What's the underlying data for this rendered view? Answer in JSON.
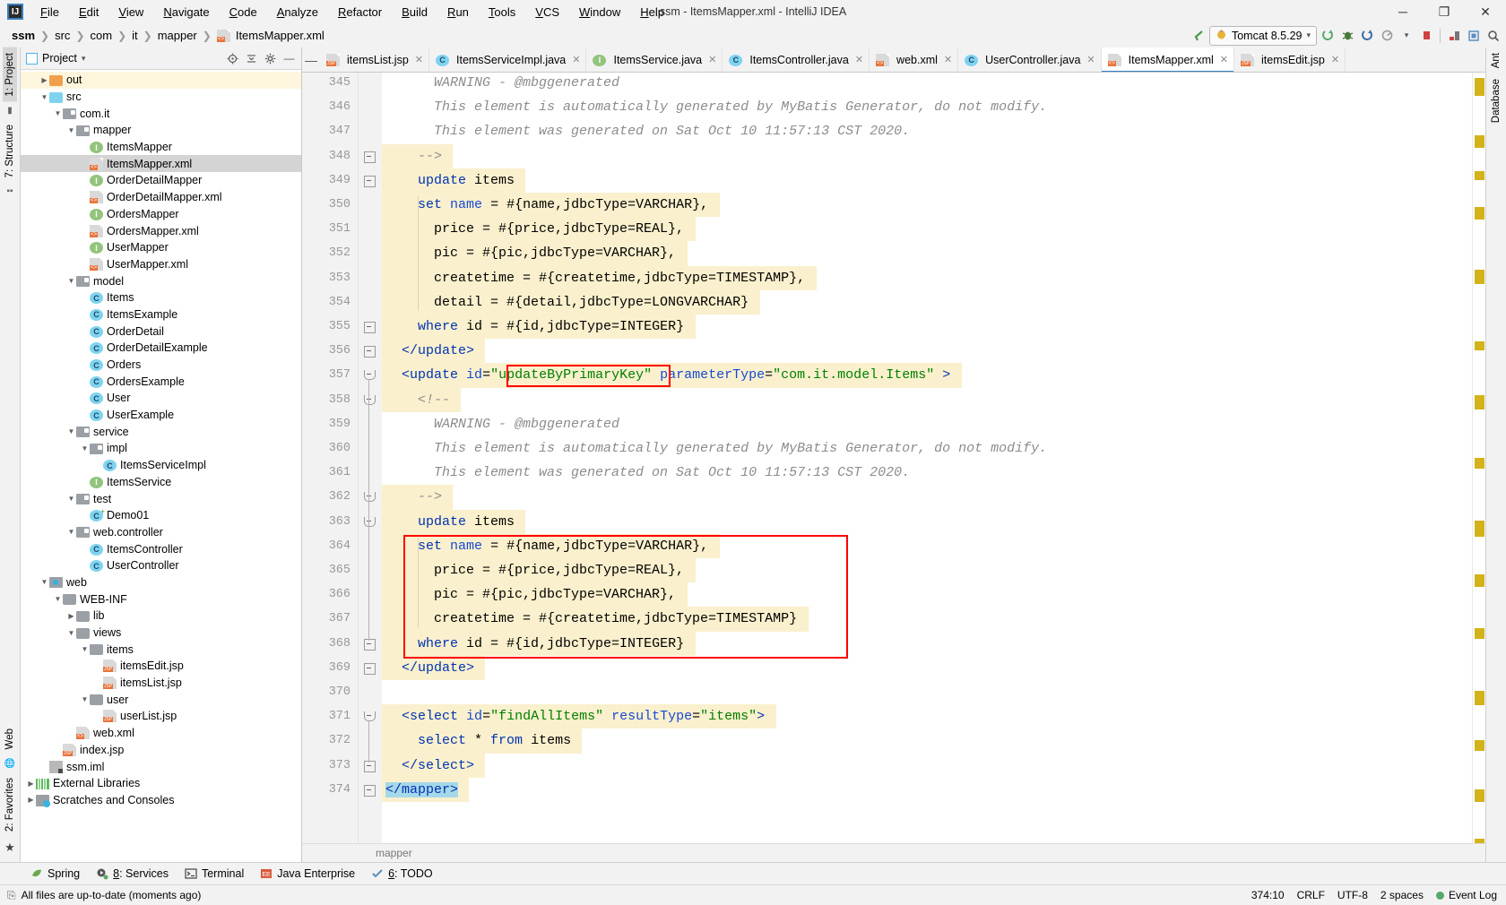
{
  "window": {
    "title": "ssm - ItemsMapper.xml - IntelliJ IDEA",
    "logo": "IJ",
    "minimize": "─",
    "maximize": "❐",
    "close": "✕"
  },
  "menu": [
    "File",
    "Edit",
    "View",
    "Navigate",
    "Code",
    "Analyze",
    "Refactor",
    "Build",
    "Run",
    "Tools",
    "VCS",
    "Window",
    "Help"
  ],
  "breadcrumbs": [
    {
      "label": "ssm",
      "bold": true,
      "icon": ""
    },
    {
      "label": "src",
      "bold": false,
      "icon": ""
    },
    {
      "label": "com",
      "bold": false,
      "icon": ""
    },
    {
      "label": "it",
      "bold": false,
      "icon": ""
    },
    {
      "label": "mapper",
      "bold": false,
      "icon": ""
    },
    {
      "label": "ItemsMapper.xml",
      "bold": false,
      "icon": "xml-file-icon"
    }
  ],
  "toolbar": {
    "back_arrow": "↖",
    "run_config": "Tomcat 8.5.29",
    "run_config_caret": "▾",
    "icons": [
      "run-icon",
      "debug-icon",
      "run-with-coverage-icon",
      "profile-icon",
      "profile-caret",
      "stop-icon",
      "build-icon",
      "app-icon",
      "search-everywhere-icon"
    ]
  },
  "left_strip": {
    "tabs": [
      {
        "label": "1: Project",
        "selected": true
      },
      {
        "label": "7: Structure",
        "selected": false
      }
    ],
    "bottom_tabs": [
      {
        "label": "Web"
      },
      {
        "label": "2: Favorites"
      }
    ]
  },
  "right_strip": {
    "tabs": [
      "Ant",
      "Database"
    ]
  },
  "project_panel": {
    "title": "Project",
    "title_caret": "▾",
    "header_icons": [
      "locate-icon",
      "collapse-all-icon",
      "settings-icon",
      "hide-icon"
    ],
    "tree": [
      {
        "label": "out",
        "depth": 1,
        "arrow": "▶",
        "icon": "folder-orange",
        "state": "highlight"
      },
      {
        "label": "src",
        "depth": 1,
        "arrow": "▼",
        "icon": "folder-blue",
        "state": ""
      },
      {
        "label": "com.it",
        "depth": 2,
        "arrow": "▼",
        "icon": "package",
        "state": ""
      },
      {
        "label": "mapper",
        "depth": 3,
        "arrow": "▼",
        "icon": "package",
        "state": ""
      },
      {
        "label": "ItemsMapper",
        "depth": 4,
        "arrow": "",
        "icon": "interface",
        "state": ""
      },
      {
        "label": "ItemsMapper.xml",
        "depth": 4,
        "arrow": "",
        "icon": "xml",
        "state": "selected"
      },
      {
        "label": "OrderDetailMapper",
        "depth": 4,
        "arrow": "",
        "icon": "interface",
        "state": ""
      },
      {
        "label": "OrderDetailMapper.xml",
        "depth": 4,
        "arrow": "",
        "icon": "xml",
        "state": ""
      },
      {
        "label": "OrdersMapper",
        "depth": 4,
        "arrow": "",
        "icon": "interface",
        "state": ""
      },
      {
        "label": "OrdersMapper.xml",
        "depth": 4,
        "arrow": "",
        "icon": "xml",
        "state": ""
      },
      {
        "label": "UserMapper",
        "depth": 4,
        "arrow": "",
        "icon": "interface",
        "state": ""
      },
      {
        "label": "UserMapper.xml",
        "depth": 4,
        "arrow": "",
        "icon": "xml",
        "state": ""
      },
      {
        "label": "model",
        "depth": 3,
        "arrow": "▼",
        "icon": "package",
        "state": ""
      },
      {
        "label": "Items",
        "depth": 4,
        "arrow": "",
        "icon": "class",
        "state": ""
      },
      {
        "label": "ItemsExample",
        "depth": 4,
        "arrow": "",
        "icon": "class",
        "state": ""
      },
      {
        "label": "OrderDetail",
        "depth": 4,
        "arrow": "",
        "icon": "class",
        "state": ""
      },
      {
        "label": "OrderDetailExample",
        "depth": 4,
        "arrow": "",
        "icon": "class",
        "state": ""
      },
      {
        "label": "Orders",
        "depth": 4,
        "arrow": "",
        "icon": "class",
        "state": ""
      },
      {
        "label": "OrdersExample",
        "depth": 4,
        "arrow": "",
        "icon": "class",
        "state": ""
      },
      {
        "label": "User",
        "depth": 4,
        "arrow": "",
        "icon": "class",
        "state": ""
      },
      {
        "label": "UserExample",
        "depth": 4,
        "arrow": "",
        "icon": "class",
        "state": ""
      },
      {
        "label": "service",
        "depth": 3,
        "arrow": "▼",
        "icon": "package",
        "state": ""
      },
      {
        "label": "impl",
        "depth": 4,
        "arrow": "▼",
        "icon": "package",
        "state": ""
      },
      {
        "label": "ItemsServiceImpl",
        "depth": 5,
        "arrow": "",
        "icon": "class",
        "state": ""
      },
      {
        "label": "ItemsService",
        "depth": 4,
        "arrow": "",
        "icon": "interface",
        "state": ""
      },
      {
        "label": "test",
        "depth": 3,
        "arrow": "▼",
        "icon": "package",
        "state": ""
      },
      {
        "label": "Demo01",
        "depth": 4,
        "arrow": "",
        "icon": "class-test",
        "state": ""
      },
      {
        "label": "web.controller",
        "depth": 3,
        "arrow": "▼",
        "icon": "package",
        "state": ""
      },
      {
        "label": "ItemsController",
        "depth": 4,
        "arrow": "",
        "icon": "class",
        "state": ""
      },
      {
        "label": "UserController",
        "depth": 4,
        "arrow": "",
        "icon": "class",
        "state": ""
      },
      {
        "label": "web",
        "depth": 1,
        "arrow": "▼",
        "icon": "webfolder",
        "state": ""
      },
      {
        "label": "WEB-INF",
        "depth": 2,
        "arrow": "▼",
        "icon": "folder",
        "state": ""
      },
      {
        "label": "lib",
        "depth": 3,
        "arrow": "▶",
        "icon": "folder",
        "state": ""
      },
      {
        "label": "views",
        "depth": 3,
        "arrow": "▼",
        "icon": "folder",
        "state": ""
      },
      {
        "label": "items",
        "depth": 4,
        "arrow": "▼",
        "icon": "folder",
        "state": ""
      },
      {
        "label": "itemsEdit.jsp",
        "depth": 5,
        "arrow": "",
        "icon": "jsp",
        "state": ""
      },
      {
        "label": "itemsList.jsp",
        "depth": 5,
        "arrow": "",
        "icon": "jsp",
        "state": ""
      },
      {
        "label": "user",
        "depth": 4,
        "arrow": "▼",
        "icon": "folder",
        "state": ""
      },
      {
        "label": "userList.jsp",
        "depth": 5,
        "arrow": "",
        "icon": "jsp",
        "state": ""
      },
      {
        "label": "web.xml",
        "depth": 3,
        "arrow": "",
        "icon": "xmlweb",
        "state": ""
      },
      {
        "label": "index.jsp",
        "depth": 2,
        "arrow": "",
        "icon": "jsp",
        "state": ""
      },
      {
        "label": "ssm.iml",
        "depth": 1,
        "arrow": "",
        "icon": "iml",
        "state": ""
      },
      {
        "label": "External Libraries",
        "depth": 0,
        "arrow": "▶",
        "icon": "library",
        "state": ""
      },
      {
        "label": "Scratches and Consoles",
        "depth": 0,
        "arrow": "▶",
        "icon": "scratch",
        "state": ""
      }
    ]
  },
  "editor_tabs": [
    {
      "label": "itemsList.jsp",
      "icon": "jsp",
      "active": false
    },
    {
      "label": "ItemsServiceImpl.java",
      "icon": "class",
      "active": false
    },
    {
      "label": "ItemsService.java",
      "icon": "interface",
      "active": false
    },
    {
      "label": "ItemsController.java",
      "icon": "class",
      "active": false
    },
    {
      "label": "web.xml",
      "icon": "xmlweb",
      "active": false
    },
    {
      "label": "UserController.java",
      "icon": "class",
      "active": false
    },
    {
      "label": "ItemsMapper.xml",
      "icon": "xml",
      "active": true
    },
    {
      "label": "itemsEdit.jsp",
      "icon": "jsp",
      "active": false
    }
  ],
  "editor": {
    "first_line_number": 345,
    "breadcrumb": "mapper",
    "lines": [
      {
        "n": 345,
        "tokens": [
          {
            "t": "      WARNING - @mbggenerated",
            "c": "cmt"
          }
        ],
        "hl": false
      },
      {
        "n": 346,
        "tokens": [
          {
            "t": "      This element is automatically generated by MyBatis Generator, do not modify.",
            "c": "cmt"
          }
        ],
        "hl": false
      },
      {
        "n": 347,
        "tokens": [
          {
            "t": "      This element was generated on Sat Oct 10 11:57:13 CST 2020.",
            "c": "cmt"
          }
        ],
        "hl": false
      },
      {
        "n": 348,
        "tokens": [
          {
            "t": "    -->",
            "c": "cmt"
          }
        ],
        "hl": true
      },
      {
        "n": 349,
        "tokens": [
          {
            "t": "    ",
            "c": "txt"
          },
          {
            "t": "update",
            "c": "kw"
          },
          {
            "t": " items",
            "c": "txt"
          }
        ],
        "hl": true
      },
      {
        "n": 350,
        "tokens": [
          {
            "t": "    ",
            "c": "txt"
          },
          {
            "t": "set",
            "c": "kw"
          },
          {
            "t": " ",
            "c": "txt"
          },
          {
            "t": "name",
            "c": "attr"
          },
          {
            "t": " = #{name,jdbcType=VARCHAR},",
            "c": "txt"
          }
        ],
        "hl": true
      },
      {
        "n": 351,
        "tokens": [
          {
            "t": "      price = #{price,jdbcType=REAL},",
            "c": "txt"
          }
        ],
        "hl": true
      },
      {
        "n": 352,
        "tokens": [
          {
            "t": "      pic = #{pic,jdbcType=VARCHAR},",
            "c": "txt"
          }
        ],
        "hl": true
      },
      {
        "n": 353,
        "tokens": [
          {
            "t": "      createtime = #{createtime,jdbcType=TIMESTAMP},",
            "c": "txt"
          }
        ],
        "hl": true
      },
      {
        "n": 354,
        "tokens": [
          {
            "t": "      detail = #{detail,jdbcType=LONGVARCHAR}",
            "c": "txt"
          }
        ],
        "hl": true
      },
      {
        "n": 355,
        "tokens": [
          {
            "t": "    ",
            "c": "txt"
          },
          {
            "t": "where",
            "c": "kw"
          },
          {
            "t": " id = #{id,jdbcType=INTEGER}",
            "c": "txt"
          }
        ],
        "hl": true
      },
      {
        "n": 356,
        "tokens": [
          {
            "t": "  ",
            "c": "txt"
          },
          {
            "t": "</update>",
            "c": "tag"
          }
        ],
        "hl": true
      },
      {
        "n": 357,
        "tokens": [
          {
            "t": "  ",
            "c": "txt"
          },
          {
            "t": "<update",
            "c": "tag"
          },
          {
            "t": " ",
            "c": "txt"
          },
          {
            "t": "id",
            "c": "attr"
          },
          {
            "t": "=",
            "c": "txt"
          },
          {
            "t": "\"updateByPrimaryKey\"",
            "c": "str"
          },
          {
            "t": " ",
            "c": "txt"
          },
          {
            "t": "parameterType",
            "c": "attr"
          },
          {
            "t": "=",
            "c": "txt"
          },
          {
            "t": "\"com.it.model.Items\"",
            "c": "str"
          },
          {
            "t": " >",
            "c": "tag"
          }
        ],
        "hl": true
      },
      {
        "n": 358,
        "tokens": [
          {
            "t": "    <!--",
            "c": "cmt"
          }
        ],
        "hl": true
      },
      {
        "n": 359,
        "tokens": [
          {
            "t": "      WARNING - @mbggenerated",
            "c": "cmt"
          }
        ],
        "hl": false
      },
      {
        "n": 360,
        "tokens": [
          {
            "t": "      This element is automatically generated by MyBatis Generator, do not modify.",
            "c": "cmt"
          }
        ],
        "hl": false
      },
      {
        "n": 361,
        "tokens": [
          {
            "t": "      This element was generated on Sat Oct 10 11:57:13 CST 2020.",
            "c": "cmt"
          }
        ],
        "hl": false
      },
      {
        "n": 362,
        "tokens": [
          {
            "t": "    -->",
            "c": "cmt"
          }
        ],
        "hl": true
      },
      {
        "n": 363,
        "tokens": [
          {
            "t": "    ",
            "c": "txt"
          },
          {
            "t": "update",
            "c": "kw"
          },
          {
            "t": " items",
            "c": "txt"
          }
        ],
        "hl": true
      },
      {
        "n": 364,
        "tokens": [
          {
            "t": "    ",
            "c": "txt"
          },
          {
            "t": "set",
            "c": "kw"
          },
          {
            "t": " ",
            "c": "txt"
          },
          {
            "t": "name",
            "c": "attr"
          },
          {
            "t": " = #{name,jdbcType=VARCHAR},",
            "c": "txt"
          }
        ],
        "hl": true
      },
      {
        "n": 365,
        "tokens": [
          {
            "t": "      price = #{price,jdbcType=REAL},",
            "c": "txt"
          }
        ],
        "hl": true
      },
      {
        "n": 366,
        "tokens": [
          {
            "t": "      pic = #{pic,jdbcType=VARCHAR},",
            "c": "txt"
          }
        ],
        "hl": true
      },
      {
        "n": 367,
        "tokens": [
          {
            "t": "      createtime = #{createtime,jdbcType=TIMESTAMP}",
            "c": "txt"
          }
        ],
        "hl": true
      },
      {
        "n": 368,
        "tokens": [
          {
            "t": "    ",
            "c": "txt"
          },
          {
            "t": "where",
            "c": "kw"
          },
          {
            "t": " id = #{id,jdbcType=INTEGER}",
            "c": "txt"
          }
        ],
        "hl": true
      },
      {
        "n": 369,
        "tokens": [
          {
            "t": "  ",
            "c": "txt"
          },
          {
            "t": "</update>",
            "c": "tag"
          }
        ],
        "hl": true
      },
      {
        "n": 370,
        "tokens": [
          {
            "t": "",
            "c": "txt"
          }
        ],
        "hl": false
      },
      {
        "n": 371,
        "tokens": [
          {
            "t": "  ",
            "c": "txt"
          },
          {
            "t": "<select",
            "c": "tag"
          },
          {
            "t": " ",
            "c": "txt"
          },
          {
            "t": "id",
            "c": "attr"
          },
          {
            "t": "=",
            "c": "txt"
          },
          {
            "t": "\"findAllItems\"",
            "c": "str"
          },
          {
            "t": " ",
            "c": "txt"
          },
          {
            "t": "resultType",
            "c": "attr"
          },
          {
            "t": "=",
            "c": "txt"
          },
          {
            "t": "\"items\"",
            "c": "str"
          },
          {
            "t": ">",
            "c": "tag"
          }
        ],
        "hl": true
      },
      {
        "n": 372,
        "tokens": [
          {
            "t": "    ",
            "c": "txt"
          },
          {
            "t": "select",
            "c": "kw"
          },
          {
            "t": " * ",
            "c": "txt"
          },
          {
            "t": "from",
            "c": "kw"
          },
          {
            "t": " items",
            "c": "txt"
          }
        ],
        "hl": true
      },
      {
        "n": 373,
        "tokens": [
          {
            "t": "  ",
            "c": "txt"
          },
          {
            "t": "</select>",
            "c": "tag"
          }
        ],
        "hl": true
      },
      {
        "n": 374,
        "tokens": [
          {
            "t": "</mapper>",
            "c": "tag",
            "sel": true
          }
        ],
        "hl": true
      }
    ]
  },
  "tool_windows": [
    {
      "label": "Spring",
      "icon": "spring-leaf-icon"
    },
    {
      "label": "8: Services",
      "icon": "services-icon"
    },
    {
      "label": "Terminal",
      "icon": "terminal-icon"
    },
    {
      "label": "Java Enterprise",
      "icon": "java-enterprise-icon"
    },
    {
      "label": "6: TODO",
      "icon": "todo-icon"
    }
  ],
  "status_bar": {
    "message": "All files are up-to-date (moments ago)",
    "caret": "374:10",
    "line_sep": "CRLF",
    "encoding": "UTF-8",
    "indent": "2 spaces",
    "event_log": "Event Log",
    "lock_icon": "⎘"
  }
}
